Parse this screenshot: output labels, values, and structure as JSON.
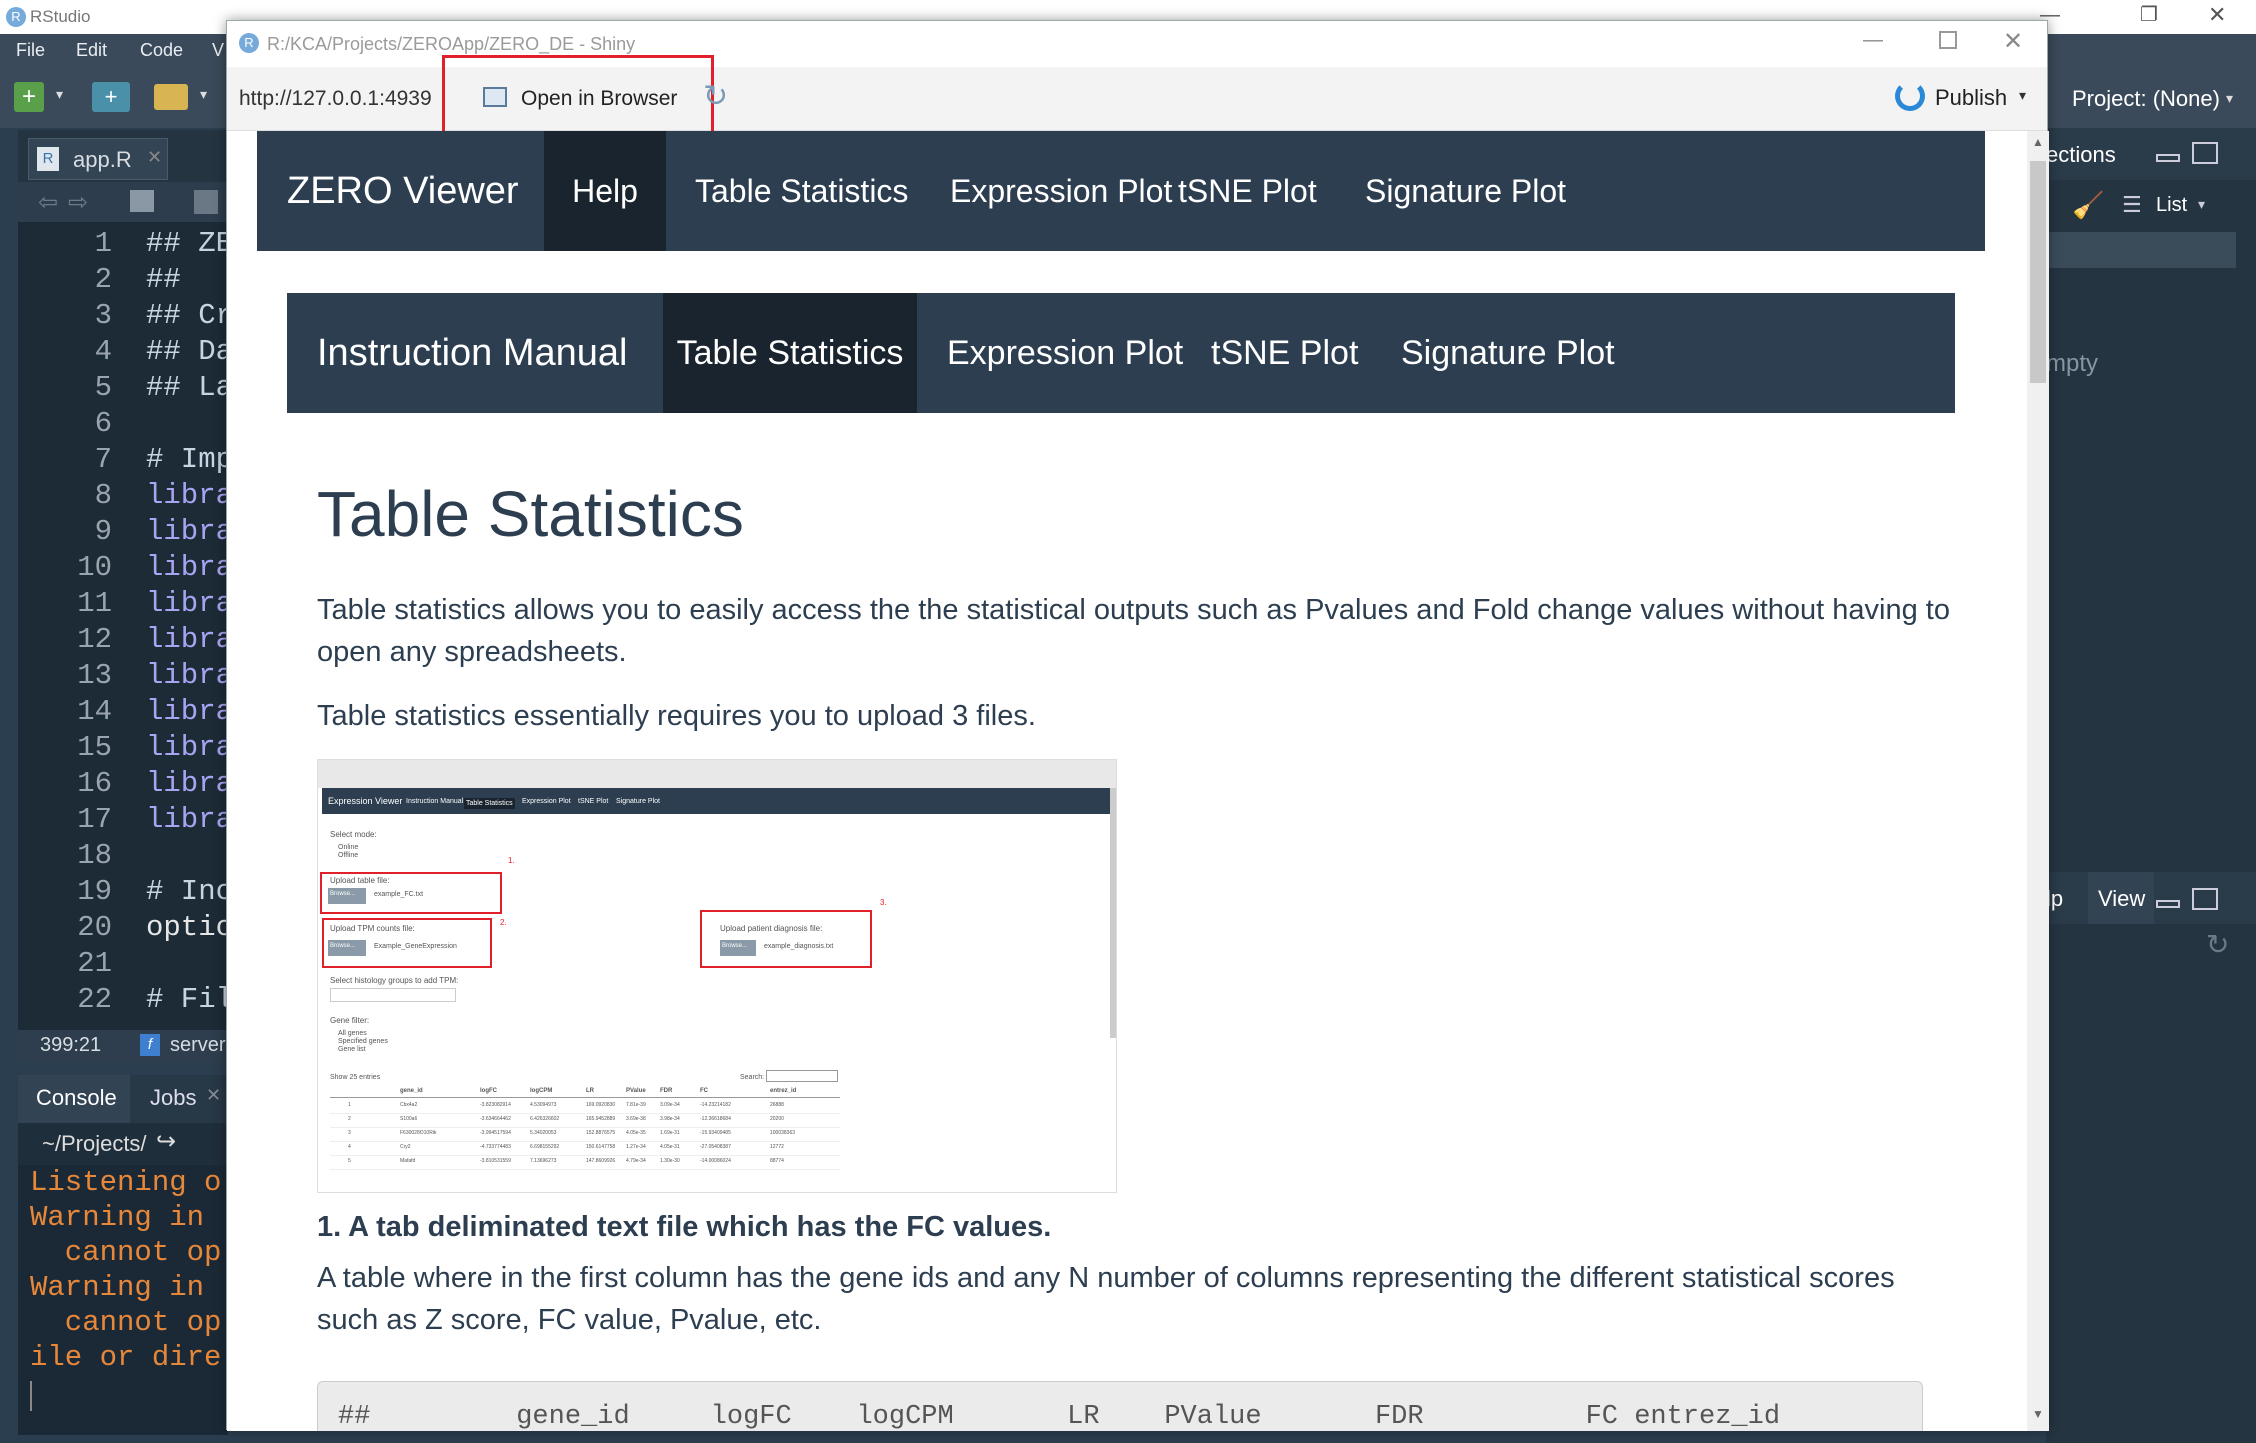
{
  "rstudio": {
    "title": "RStudio",
    "menu": [
      "File",
      "Edit",
      "Code",
      "V"
    ],
    "project": "Project: (None)"
  },
  "editor": {
    "tab": "app.R",
    "lines": [
      {
        "n": "1",
        "code": "## ZE"
      },
      {
        "n": "2",
        "code": "##"
      },
      {
        "n": "3",
        "code": "## Cr"
      },
      {
        "n": "4",
        "code": "## Da"
      },
      {
        "n": "5",
        "code": "## La"
      },
      {
        "n": "6",
        "code": ""
      },
      {
        "n": "7",
        "code": "# Imp"
      },
      {
        "n": "8",
        "code": "libra"
      },
      {
        "n": "9",
        "code": "libra"
      },
      {
        "n": "10",
        "code": "libra"
      },
      {
        "n": "11",
        "code": "libra"
      },
      {
        "n": "12",
        "code": "libra"
      },
      {
        "n": "13",
        "code": "libra"
      },
      {
        "n": "14",
        "code": "libra"
      },
      {
        "n": "15",
        "code": "libra"
      },
      {
        "n": "16",
        "code": "libra"
      },
      {
        "n": "17",
        "code": "libra"
      },
      {
        "n": "18",
        "code": ""
      },
      {
        "n": "19",
        "code": "# Inc"
      },
      {
        "n": "20",
        "code": "optic"
      },
      {
        "n": "21",
        "code": ""
      },
      {
        "n": "22",
        "code": "# Fil"
      }
    ],
    "position": "399:21",
    "scope": "server"
  },
  "console": {
    "tabs": [
      "Console",
      "Jobs"
    ],
    "path": "~/Projects/",
    "lines": [
      "Listening o",
      "Warning in ",
      "  cannot op",
      "Warning in ",
      "  cannot op",
      "ile or dire"
    ]
  },
  "right_pane": {
    "tab_top": "ections",
    "list_label": "List",
    "empty_text": "mpty",
    "tab_help": "lp",
    "tab_viewer": "View"
  },
  "shiny_window": {
    "title": "R:/KCA/Projects/ZEROApp/ZERO_DE - Shiny",
    "url": "http://127.0.0.1:4939",
    "open_in_browser": "Open in Browser",
    "publish": "Publish"
  },
  "app": {
    "brand": "ZERO Viewer",
    "nav": [
      "Help",
      "Table Statistics",
      "Expression Plot",
      "tSNE Plot",
      "Signature Plot"
    ],
    "subnav": [
      "Instruction Manual",
      "Table Statistics",
      "Expression Plot",
      "tSNE Plot",
      "Signature Plot"
    ],
    "heading": "Table Statistics",
    "para1": "Table statistics allows you to easily access the the statistical outputs such as Pvalues and Fold change values without having to open any spreadsheets.",
    "para2": "Table statistics essentially requires you to upload 3 files.",
    "h4_1": "1. A tab deliminated text file which has the FC values.",
    "para3": "A table where in the first column has the gene ids and any N number of columns representing the different statistical scores such as Z score, FC value, Pvalue, etc.",
    "code_header": "##         gene_id     logFC    logCPM       LR    PValue       FDR          FC entrez_id"
  },
  "thumbnail": {
    "brand": "Expression Viewer",
    "nav": [
      "Instruction Manual",
      "Table Statistics",
      "Expression Plot",
      "tSNE Plot",
      "Signature Plot"
    ],
    "select_mode": "Select mode:",
    "mode_online": "Online",
    "mode_offline": "Offline",
    "upload_table": "Upload table file:",
    "file_fc": "example_FC.txt",
    "upload_tpm": "Upload TPM counts file:",
    "file_tpm": "Example_GeneExpression",
    "upload_patient": "Upload patient diagnosis file:",
    "file_patient": "example_diagnosis.txt",
    "browse": "Browse...",
    "histology": "Select histology groups to add TPM:",
    "gene_filter": "Gene filter:",
    "gf_all": "All genes",
    "gf_specified": "Specified genes",
    "gf_list": "Gene list",
    "show_entries": "Show 25 entries",
    "search": "Search:",
    "columns": [
      "gene_id",
      "logFC",
      "logCPM",
      "LR",
      "PValue",
      "FDR",
      "FC",
      "entrez_id"
    ],
    "rows": [
      [
        "1",
        "Cbx4a2",
        "-3.823082914",
        "4.53094973",
        "169.0920830",
        "7.81e-39",
        "3.09e-34",
        "-14.23214182",
        "26888"
      ],
      [
        "2",
        "S100a6",
        "-3.634664462",
        "6.426326602",
        "165.9452889",
        "3.69e-38",
        "3.98e-34",
        "-12.36618684",
        "20200"
      ],
      [
        "3",
        "F630028O10Rik",
        "-3.994517594",
        "5.34020053",
        "152.8876575",
        "4.05e-35",
        "1.69e-31",
        "-15.93409485",
        "100038363"
      ],
      [
        "4",
        "Cry2",
        "-4.733774483",
        "6.698155292",
        "150.6147758",
        "1.27e-34",
        "4.05e-31",
        "-27.05408387",
        "12772"
      ],
      [
        "5",
        "Mafafd",
        "-3.810531559",
        "7.13696273",
        "147.8609926",
        "4.79e-34",
        "1.30e-30",
        "-14.00086024",
        "88774"
      ]
    ],
    "markers": [
      "1.",
      "2.",
      "3."
    ]
  }
}
